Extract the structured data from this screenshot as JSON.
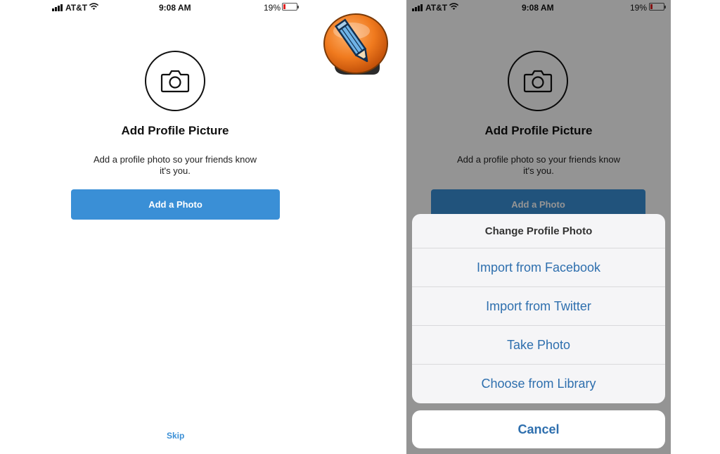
{
  "status_bar": {
    "carrier": "AT&T",
    "time": "9:08 AM",
    "battery": "19%",
    "battery_level": 0.19,
    "icons": [
      "signal-bars-icon",
      "wifi-icon",
      "battery-icon"
    ]
  },
  "add_profile": {
    "icon": "camera-icon",
    "title": "Add Profile Picture",
    "subtitle_line1": "Add a profile photo so your friends know",
    "subtitle_line2": "it's you.",
    "add_photo_label": "Add a Photo",
    "skip_label": "Skip"
  },
  "app_logo": {
    "icon": "pencil-icon",
    "color": "#f07a1e"
  },
  "action_sheet": {
    "title": "Change Profile Photo",
    "options": [
      {
        "label": "Import from Facebook"
      },
      {
        "label": "Import from Twitter"
      },
      {
        "label": "Take Photo"
      },
      {
        "label": "Choose from Library"
      }
    ],
    "cancel_label": "Cancel"
  },
  "colors": {
    "accent": "#3a8fd6",
    "accent_dimmed": "#2a5f8f",
    "sheet_text": "#2e6fae",
    "battery_low": "#e02020"
  }
}
